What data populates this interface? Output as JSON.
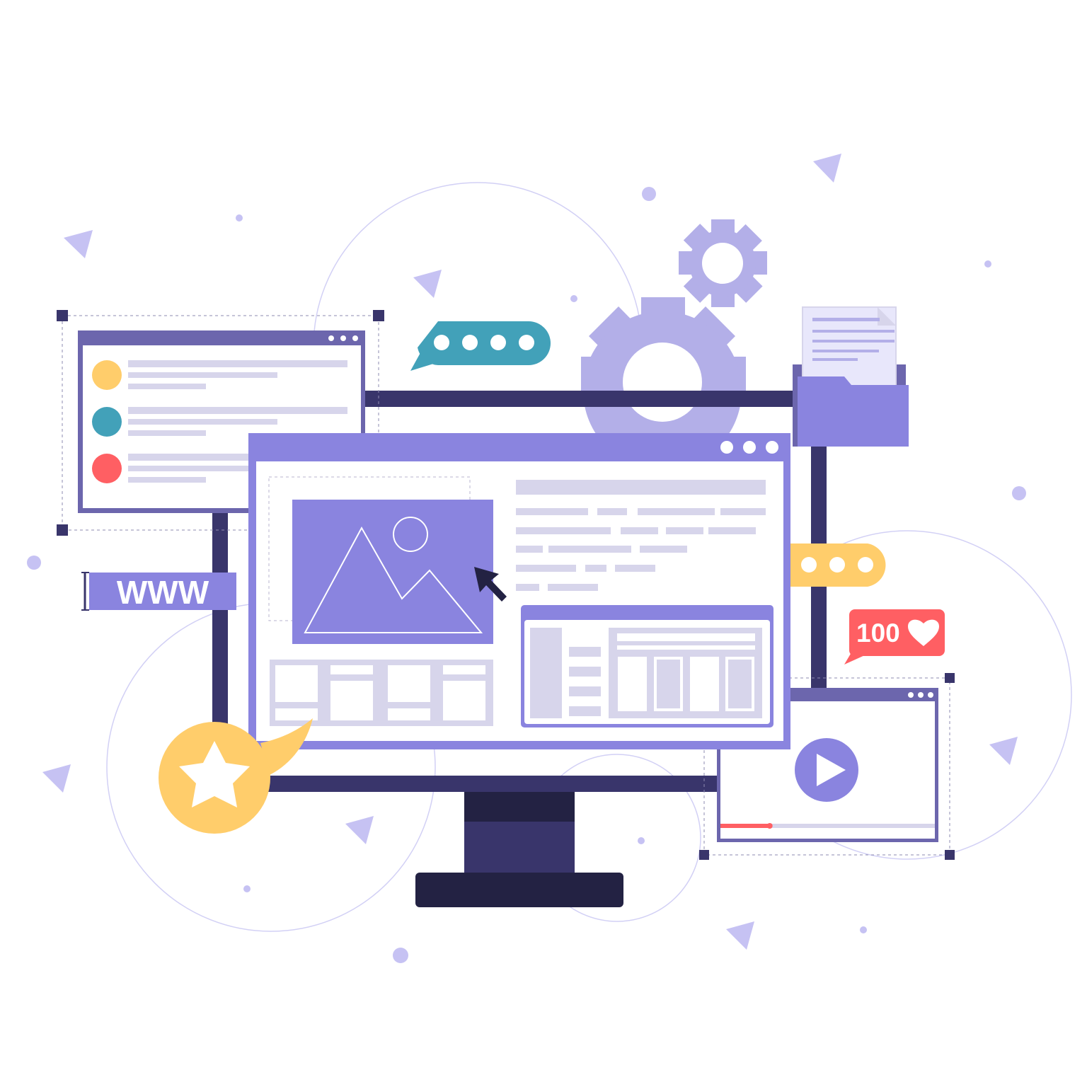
{
  "labels": {
    "www": "WWW",
    "likes_count": "100"
  },
  "colors": {
    "background": "#ffffff",
    "navy": "#39356b",
    "dark_navy": "#232243",
    "purple": "#8a84df",
    "dark_purple": "#6c66ad",
    "lavender": "#b3afe8",
    "light_lavender": "#d7d5eb",
    "pale_lavender": "#e8e7fb",
    "yellow": "#ffcd6b",
    "teal": "#42a1b9",
    "coral": "#ff5f63",
    "decoration": "#c6c2f3"
  },
  "icons": [
    "gear-icon",
    "folder-icon",
    "document-icon",
    "chat-bubble-icon",
    "star-icon",
    "heart-icon",
    "play-icon",
    "cursor-icon",
    "image-placeholder-icon",
    "dots-icon"
  ],
  "video_player": {
    "progress": 0.23
  }
}
